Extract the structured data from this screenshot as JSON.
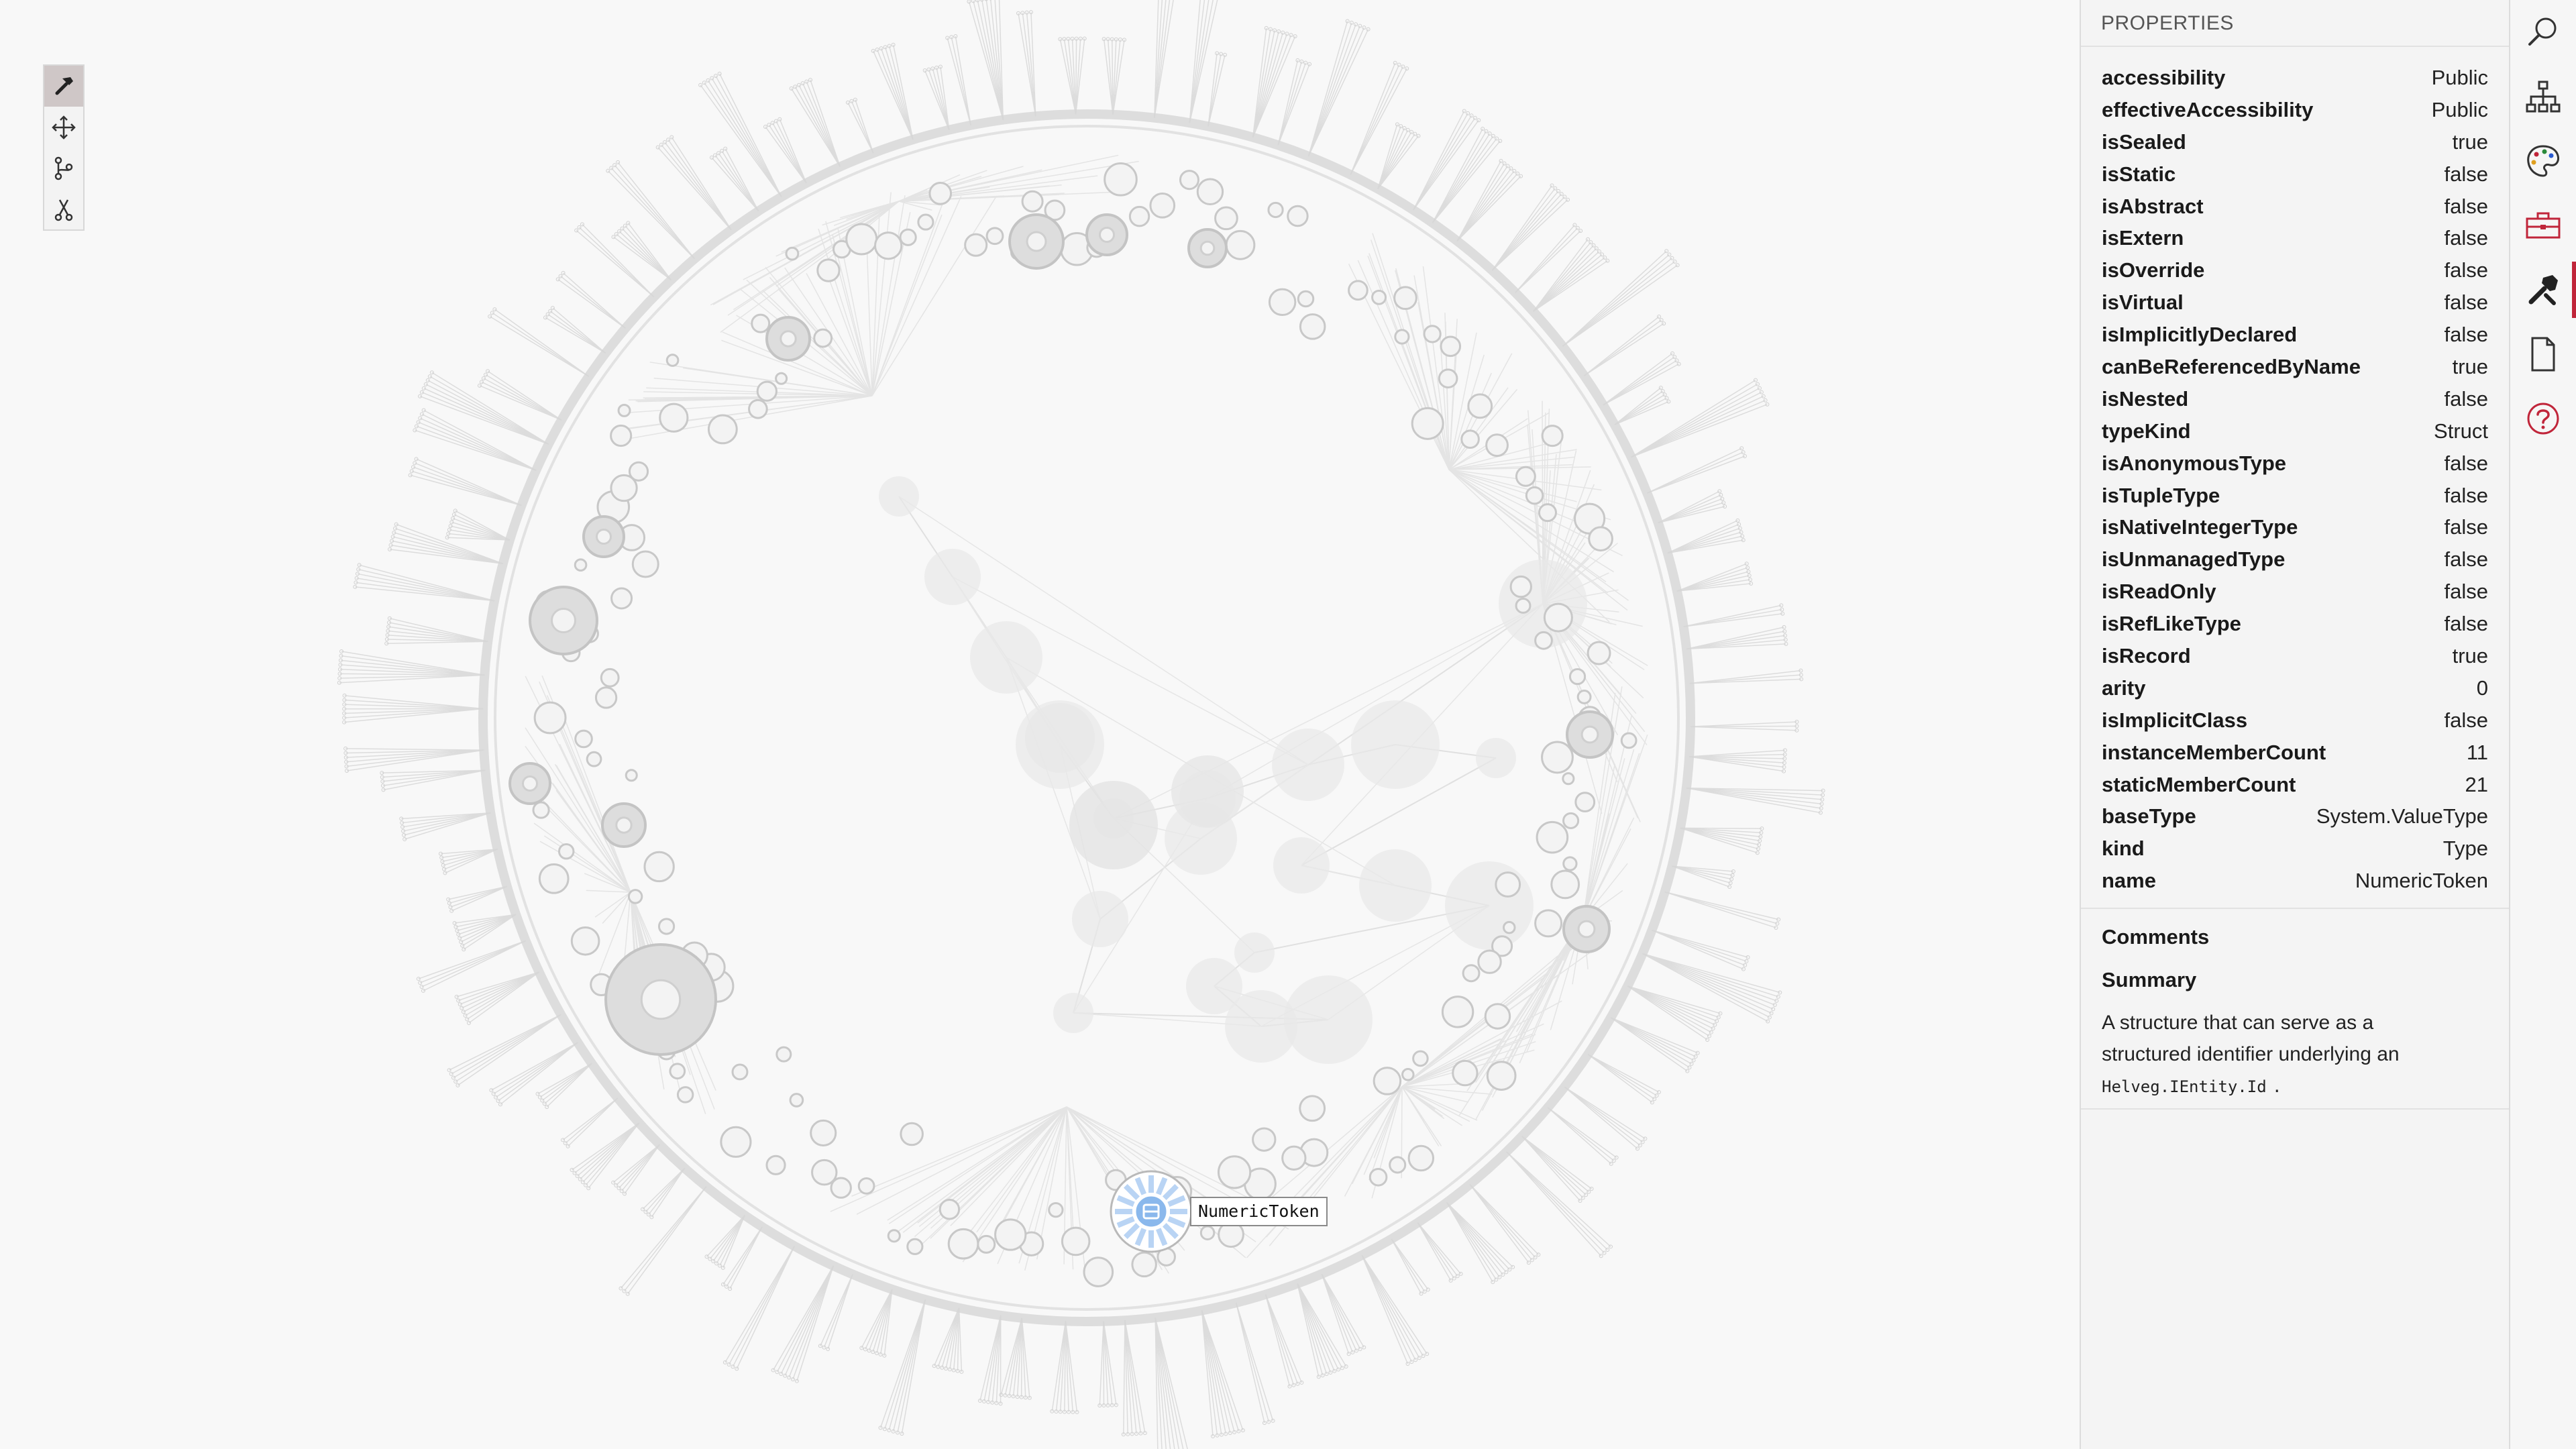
{
  "graph": {
    "selected_node_label": "NumericToken"
  },
  "tools": [
    {
      "name": "hammer-tool",
      "active": true
    },
    {
      "name": "move-tool",
      "active": false
    },
    {
      "name": "branch-tool",
      "active": false
    },
    {
      "name": "cut-tool",
      "active": false
    }
  ],
  "properties": {
    "title": "PROPERTIES",
    "rows": [
      {
        "key": "accessibility",
        "value": "Public"
      },
      {
        "key": "effectiveAccessibility",
        "value": "Public"
      },
      {
        "key": "isSealed",
        "value": "true"
      },
      {
        "key": "isStatic",
        "value": "false"
      },
      {
        "key": "isAbstract",
        "value": "false"
      },
      {
        "key": "isExtern",
        "value": "false"
      },
      {
        "key": "isOverride",
        "value": "false"
      },
      {
        "key": "isVirtual",
        "value": "false"
      },
      {
        "key": "isImplicitlyDeclared",
        "value": "false"
      },
      {
        "key": "canBeReferencedByName",
        "value": "true"
      },
      {
        "key": "isNested",
        "value": "false"
      },
      {
        "key": "typeKind",
        "value": "Struct"
      },
      {
        "key": "isAnonymousType",
        "value": "false"
      },
      {
        "key": "isTupleType",
        "value": "false"
      },
      {
        "key": "isNativeIntegerType",
        "value": "false"
      },
      {
        "key": "isUnmanagedType",
        "value": "false"
      },
      {
        "key": "isReadOnly",
        "value": "false"
      },
      {
        "key": "isRefLikeType",
        "value": "false"
      },
      {
        "key": "isRecord",
        "value": "true"
      },
      {
        "key": "arity",
        "value": "0"
      },
      {
        "key": "isImplicitClass",
        "value": "false"
      },
      {
        "key": "instanceMemberCount",
        "value": "11"
      },
      {
        "key": "staticMemberCount",
        "value": "21"
      },
      {
        "key": "baseType",
        "value": "System.ValueType"
      },
      {
        "key": "kind",
        "value": "Type"
      },
      {
        "key": "name",
        "value": "NumericToken"
      }
    ],
    "comments_heading": "Comments",
    "summary_heading": "Summary",
    "summary_text": "A structure that can serve as a structured identifier underlying an",
    "summary_code": "Helveg.IEntity.Id",
    "summary_end": "."
  },
  "sidebar": [
    {
      "name": "search-icon",
      "active": false
    },
    {
      "name": "hierarchy-icon",
      "active": false
    },
    {
      "name": "palette-icon",
      "active": false
    },
    {
      "name": "toolbox-icon",
      "active": false
    },
    {
      "name": "wrench-icon",
      "active": true
    },
    {
      "name": "document-icon",
      "active": false
    },
    {
      "name": "help-icon",
      "active": false
    }
  ],
  "colors": {
    "accent": "#c0253a",
    "selected_node": "#6ea6e6",
    "graph_gray": "#c8c8c8"
  }
}
